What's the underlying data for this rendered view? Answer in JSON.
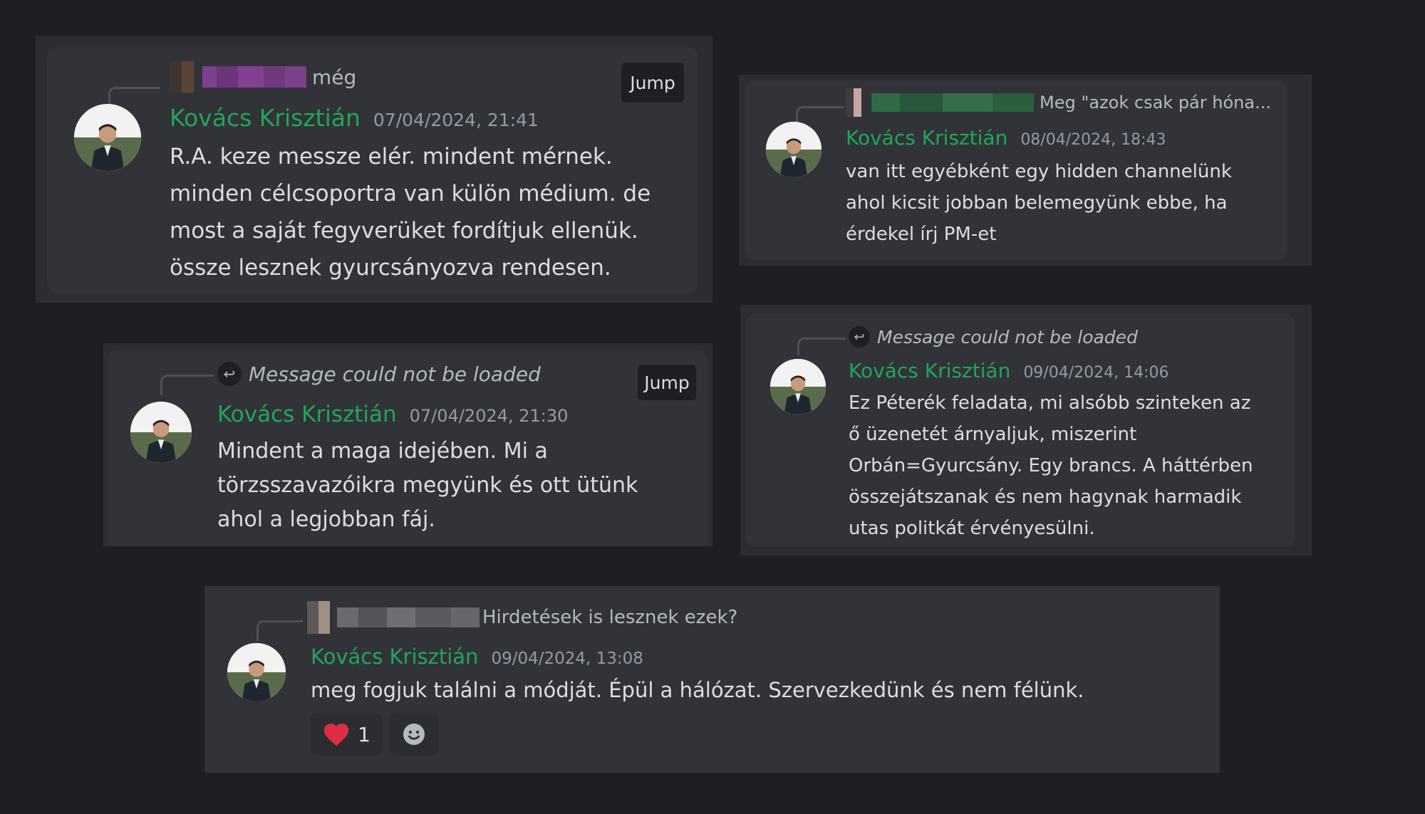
{
  "jump_label": "Jump",
  "messages": [
    {
      "author": "Kovács Krisztián",
      "timestamp": "07/04/2024, 21:41",
      "reply_preview": "még",
      "lines": [
        "R.A. keze messze elér. mindent mérnek.",
        "minden célcsoportra van külön médium. de",
        "most a saját fegyverüket fordítjuk ellenük.",
        "össze lesznek gyurcsányozva rendesen."
      ]
    },
    {
      "author": "Kovács Krisztián",
      "timestamp": "08/04/2024, 18:43",
      "reply_preview": "Meg \"azok csak pár hóna...",
      "lines": [
        "van itt egyébként egy hidden channelünk",
        "ahol kicsit jobban belemegyünk ebbe, ha",
        "érdekel írj PM-et"
      ]
    },
    {
      "author": "Kovács Krisztián",
      "timestamp": "07/04/2024, 21:30",
      "reply_preview": "Message could not be loaded",
      "lines": [
        "Mindent a maga idejében. Mi a",
        "törzsszavazóikra megyünk és ott ütünk",
        "ahol a legjobban fáj."
      ]
    },
    {
      "author": "Kovács Krisztián",
      "timestamp": "09/04/2024, 14:06",
      "reply_preview": "Message could not be loaded",
      "lines": [
        "Ez Péterék feladata, mi alsóbb szinteken az",
        "ő üzenetét árnyaljuk, miszerint",
        "Orbán=Gyurcsány. Egy brancs. A háttérben",
        "összejátszanak és nem hagynak harmadik",
        "utas politkát érvényesülni."
      ]
    },
    {
      "author": "Kovács Krisztián",
      "timestamp": "09/04/2024, 13:08",
      "reply_preview": "Hirdetések is lesznek ezek?",
      "lines": [
        "meg fogjuk találni a módját. Épül a hálózat. Szervezkedünk és nem félünk."
      ],
      "reactions": [
        {
          "icon": "heart-icon",
          "count": "1"
        },
        {
          "icon": "add-reaction-icon",
          "count": ""
        }
      ]
    }
  ]
}
